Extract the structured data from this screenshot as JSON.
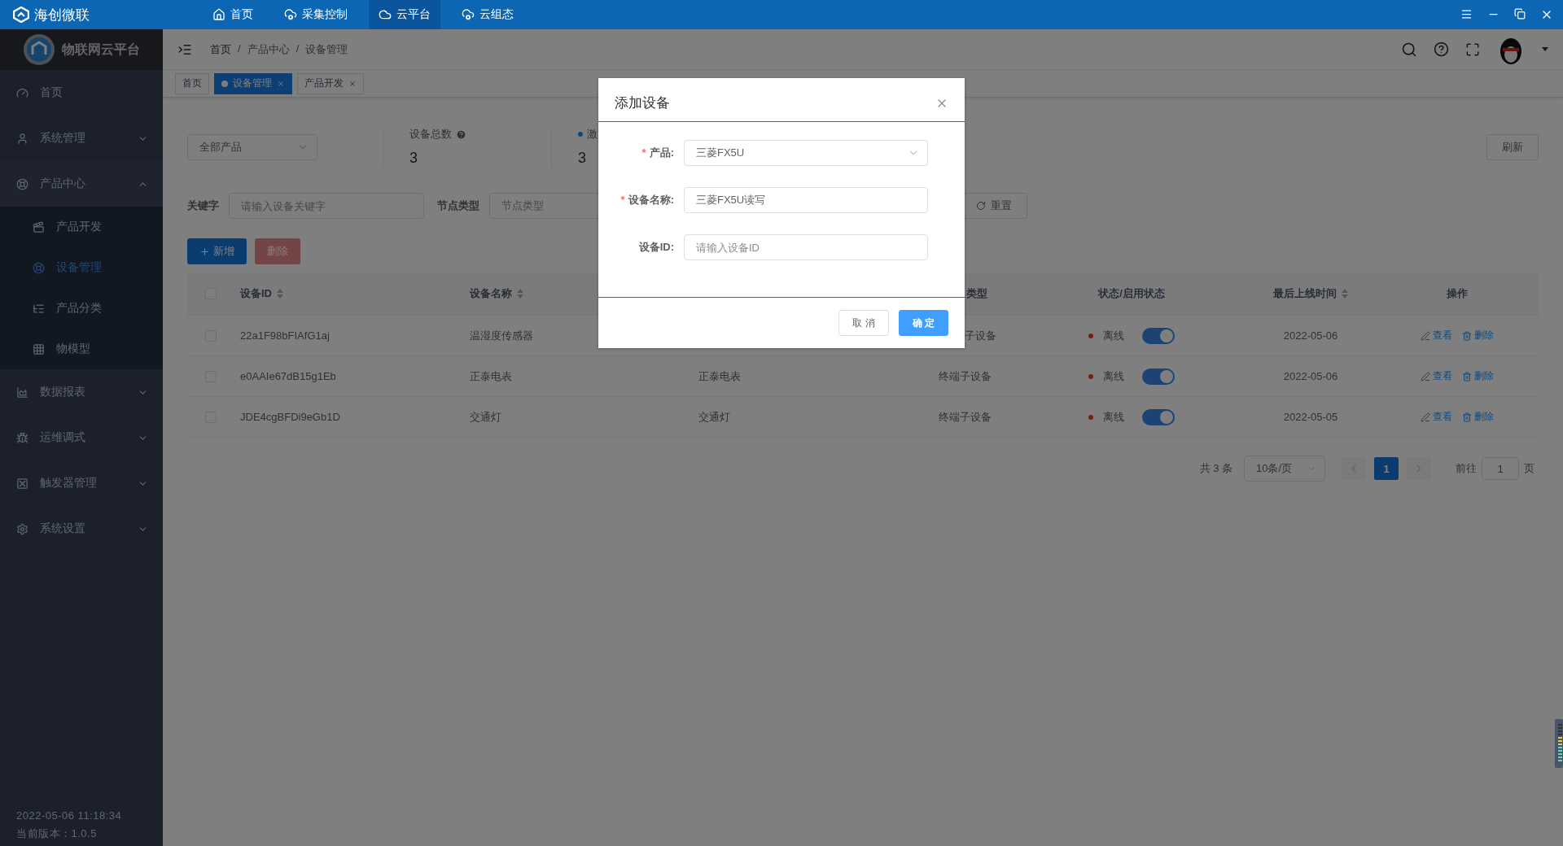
{
  "titlebar": {
    "brand": "海创微联",
    "nav": [
      {
        "label": "首页",
        "selected": false
      },
      {
        "label": "采集控制",
        "selected": false
      },
      {
        "label": "云平台",
        "selected": true
      },
      {
        "label": "云组态",
        "selected": false
      }
    ]
  },
  "sidebar": {
    "title": "物联网云平台",
    "items": [
      {
        "label": "首页",
        "selected": false
      },
      {
        "label": "系统管理",
        "expanded": false,
        "selected": false
      },
      {
        "label": "产品中心",
        "expanded": true,
        "selected": false,
        "children": [
          {
            "label": "产品开发",
            "selected": false
          },
          {
            "label": "设备管理",
            "selected": true
          },
          {
            "label": "产品分类",
            "selected": false
          },
          {
            "label": "物模型",
            "selected": false
          }
        ]
      },
      {
        "label": "数据报表",
        "expanded": false,
        "selected": false
      },
      {
        "label": "运维调式",
        "expanded": false,
        "selected": false
      },
      {
        "label": "触发器管理",
        "expanded": false,
        "selected": false
      },
      {
        "label": "系统设置",
        "expanded": false,
        "selected": false
      }
    ],
    "datetime": "2022-05-06 11:18:34",
    "version": "当前版本：1.0.5"
  },
  "breadcrumb": {
    "separator": "/",
    "items": [
      "首页",
      "产品中心",
      "设备管理"
    ]
  },
  "tags": [
    {
      "label": "首页",
      "selected": false,
      "closable": false
    },
    {
      "label": "设备管理",
      "selected": true,
      "closable": true
    },
    {
      "label": "产品开发",
      "selected": false,
      "closable": true
    }
  ],
  "filters": {
    "product_select": "全部产品",
    "stats": [
      {
        "kind": "help",
        "label": "设备总数",
        "value": "3"
      },
      {
        "kind": "dot",
        "label": "激",
        "value": "3"
      }
    ],
    "refresh": "刷新",
    "keyword_label": "关键字",
    "keyword_placeholder": "请输入设备关键字",
    "node_type_label": "节点类型",
    "node_type_placeholder": "节点类型",
    "reset": "重置"
  },
  "actions": {
    "add": "新增",
    "delete": {
      "label": "删除",
      "disabled": true
    }
  },
  "table": {
    "all_checked": false,
    "columns": [
      {
        "label": "设备ID",
        "sortable": true
      },
      {
        "label": "设备名称",
        "sortable": true
      },
      {
        "label": "类型",
        "sortable": false
      },
      {
        "label": "状态/启用状态",
        "sortable": false
      },
      {
        "label": "最后上线时间",
        "sortable": true
      },
      {
        "label": "操作",
        "sortable": false
      }
    ],
    "rows": [
      {
        "checked": false,
        "id": "22a1F98bFIAfG1aj",
        "name": "温湿度传感器",
        "node_type": "子设备",
        "status": "离线",
        "on": true,
        "last_online": "2022-05-06",
        "actions": [
          "查看",
          "删除"
        ]
      },
      {
        "checked": false,
        "id": "e0AAIe67dB15g1Eb",
        "name": "正泰电表",
        "product": "正泰电表",
        "node_type": "终端子设备",
        "status": "离线",
        "on": true,
        "last_online": "2022-05-06",
        "actions": [
          "查看",
          "删除"
        ]
      },
      {
        "checked": false,
        "id": "JDE4cgBFDi9eGb1D",
        "name": "交通灯",
        "product": "交通灯",
        "node_type": "终端子设备",
        "status": "离线",
        "on": true,
        "last_online": "2022-05-05",
        "actions": [
          "查看",
          "删除"
        ]
      }
    ]
  },
  "pagination": {
    "total": "共 3 条",
    "page_size": "10条/页",
    "pages": [
      {
        "label": "1",
        "selected": true
      }
    ],
    "goto_label": "前往",
    "goto_value": "1",
    "goto_suffix": "页"
  },
  "dialog": {
    "title": "添加设备",
    "required_mark": "*",
    "fields": [
      {
        "kind": "select",
        "label": "产品:",
        "required": true,
        "value": "三菱FX5U"
      },
      {
        "kind": "input",
        "label": "设备名称:",
        "required": true,
        "value": "三菱FX5U读写"
      },
      {
        "kind": "input",
        "label": "设备ID:",
        "required": false,
        "placeholder": "请输入设备ID"
      }
    ],
    "buttons": [
      {
        "label": "取 消",
        "primary": false
      },
      {
        "label": "确 定",
        "primary": true
      }
    ]
  }
}
